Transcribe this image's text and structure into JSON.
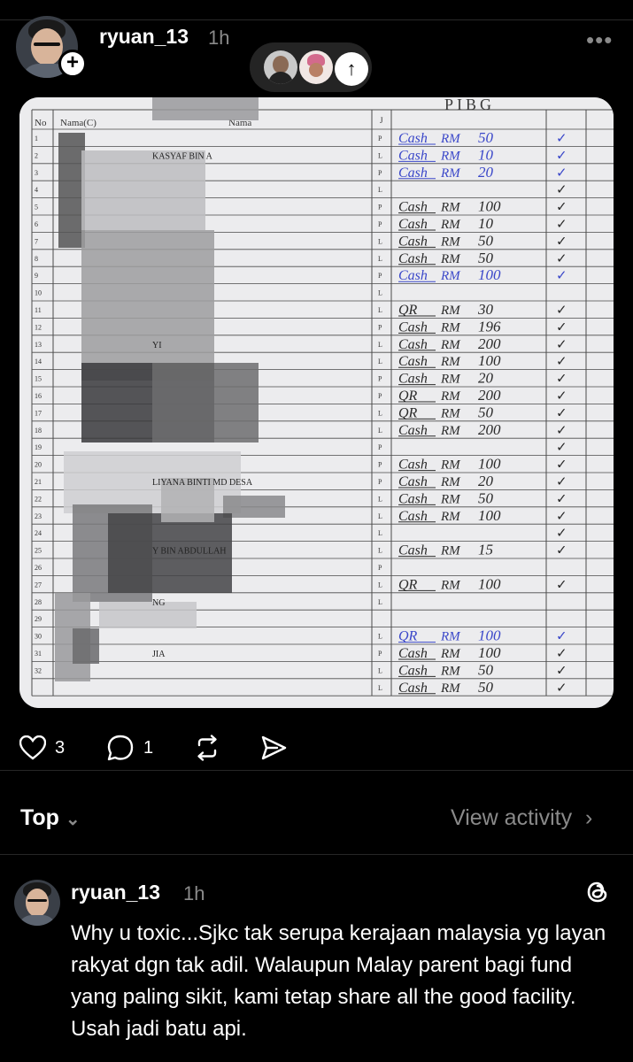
{
  "post": {
    "username": "ryuan_13",
    "time": "1h",
    "more_label": "•••",
    "plus_label": "+",
    "up_arrow": "↑"
  },
  "sheet": {
    "header_title": "PIBG",
    "col_no": "No",
    "col_nama_c": "Nama(C)",
    "col_nama": "Nama",
    "col_j": "J",
    "visible_names": [
      {
        "row": 2,
        "text": "KASYAF BIN A"
      },
      {
        "row": 13,
        "text": "YI"
      },
      {
        "row": 21,
        "text": "LIYANA BINTI MD DESA"
      },
      {
        "row": 25,
        "text": "Y BIN ABDULLAH"
      },
      {
        "row": 28,
        "text": "NG"
      },
      {
        "row": 31,
        "text": "JIA"
      }
    ],
    "rows": [
      {
        "no": "1",
        "g": "P",
        "method": "Cash",
        "cur": "RM",
        "amt": "50",
        "tick": "✓",
        "blue": true
      },
      {
        "no": "2",
        "g": "L",
        "method": "Cash",
        "cur": "RM",
        "amt": "10",
        "tick": "✓",
        "blue": true
      },
      {
        "no": "3",
        "g": "P",
        "method": "Cash",
        "cur": "RM",
        "amt": "20",
        "tick": "✓",
        "blue": true
      },
      {
        "no": "4",
        "g": "L",
        "method": "",
        "cur": "",
        "amt": "",
        "tick": "✓",
        "blue": false
      },
      {
        "no": "5",
        "g": "P",
        "method": "Cash",
        "cur": "RM",
        "amt": "100",
        "tick": "✓",
        "blue": false
      },
      {
        "no": "6",
        "g": "P",
        "method": "Cash",
        "cur": "RM",
        "amt": "10",
        "tick": "✓",
        "blue": false
      },
      {
        "no": "7",
        "g": "L",
        "method": "Cash",
        "cur": "RM",
        "amt": "50",
        "tick": "✓",
        "blue": false
      },
      {
        "no": "8",
        "g": "L",
        "method": "Cash",
        "cur": "RM",
        "amt": "50",
        "tick": "✓",
        "blue": false
      },
      {
        "no": "9",
        "g": "P",
        "method": "Cash",
        "cur": "RM",
        "amt": "100",
        "tick": "✓",
        "blue": true
      },
      {
        "no": "10",
        "g": "L",
        "method": "",
        "cur": "",
        "amt": "",
        "tick": "",
        "blue": false
      },
      {
        "no": "11",
        "g": "L",
        "method": "QR",
        "cur": "RM",
        "amt": "30",
        "tick": "✓",
        "blue": false
      },
      {
        "no": "12",
        "g": "P",
        "method": "Cash",
        "cur": "RM",
        "amt": "196",
        "tick": "✓",
        "blue": false
      },
      {
        "no": "13",
        "g": "L",
        "method": "Cash",
        "cur": "RM",
        "amt": "200",
        "tick": "✓",
        "blue": false
      },
      {
        "no": "14",
        "g": "L",
        "method": "Cash",
        "cur": "RM",
        "amt": "100",
        "tick": "✓",
        "blue": false
      },
      {
        "no": "15",
        "g": "P",
        "method": "Cash",
        "cur": "RM",
        "amt": "20",
        "tick": "✓",
        "blue": false
      },
      {
        "no": "16",
        "g": "P",
        "method": "QR",
        "cur": "RM",
        "amt": "200",
        "tick": "✓",
        "blue": false
      },
      {
        "no": "17",
        "g": "L",
        "method": "QR",
        "cur": "RM",
        "amt": "50",
        "tick": "✓",
        "blue": false
      },
      {
        "no": "18",
        "g": "L",
        "method": "Cash",
        "cur": "RM",
        "amt": "200",
        "tick": "✓",
        "blue": false
      },
      {
        "no": "19",
        "g": "P",
        "method": "",
        "cur": "",
        "amt": "",
        "tick": "✓",
        "blue": false
      },
      {
        "no": "20",
        "g": "P",
        "method": "Cash",
        "cur": "RM",
        "amt": "100",
        "tick": "✓",
        "blue": false
      },
      {
        "no": "21",
        "g": "P",
        "method": "Cash",
        "cur": "RM",
        "amt": "20",
        "tick": "✓",
        "blue": false
      },
      {
        "no": "22",
        "g": "L",
        "method": "Cash",
        "cur": "RM",
        "amt": "50",
        "tick": "✓",
        "blue": false
      },
      {
        "no": "23",
        "g": "L",
        "method": "Cash",
        "cur": "RM",
        "amt": "100",
        "tick": "✓",
        "blue": false
      },
      {
        "no": "24",
        "g": "L",
        "method": "",
        "cur": "",
        "amt": "",
        "tick": "✓",
        "blue": false
      },
      {
        "no": "25",
        "g": "L",
        "method": "Cash",
        "cur": "RM",
        "amt": "15",
        "tick": "✓",
        "blue": false
      },
      {
        "no": "26",
        "g": "P",
        "method": "",
        "cur": "",
        "amt": "",
        "tick": "",
        "blue": false
      },
      {
        "no": "27",
        "g": "L",
        "method": "QR",
        "cur": "RM",
        "amt": "100",
        "tick": "✓",
        "blue": false
      },
      {
        "no": "28",
        "g": "L",
        "method": "",
        "cur": "",
        "amt": "",
        "tick": "",
        "blue": false
      },
      {
        "no": "29",
        "g": "",
        "method": "",
        "cur": "",
        "amt": "",
        "tick": "",
        "blue": false
      },
      {
        "no": "30",
        "g": "L",
        "method": "QR",
        "cur": "RM",
        "amt": "100",
        "tick": "✓",
        "blue": true
      },
      {
        "no": "31",
        "g": "P",
        "method": "Cash",
        "cur": "RM",
        "amt": "100",
        "tick": "✓",
        "blue": false
      },
      {
        "no": "32",
        "g": "L",
        "method": "Cash",
        "cur": "RM",
        "amt": "50",
        "tick": "✓",
        "blue": false
      },
      {
        "no": "",
        "g": "L",
        "method": "Cash",
        "cur": "RM",
        "amt": "50",
        "tick": "✓",
        "blue": false
      }
    ]
  },
  "actions": {
    "likes": "3",
    "comments": "1"
  },
  "sort": {
    "label": "Top",
    "chevron": "⌄",
    "view_activity": "View activity",
    "arrow": "›"
  },
  "reply": {
    "username": "ryuan_13",
    "time": "1h",
    "text": "Why u toxic...Sjkc tak serupa kerajaan malaysia yg layan rakyat dgn tak adil. Walaupun Malay parent bagi fund yang paling sikit, kami tetap share all the good facility. Usah jadi batu api."
  },
  "colors": {
    "background": "#000000",
    "muted": "#8a8a8a",
    "ink_blue": "#3a47c9",
    "ink_dark": "#2a2a2a"
  }
}
